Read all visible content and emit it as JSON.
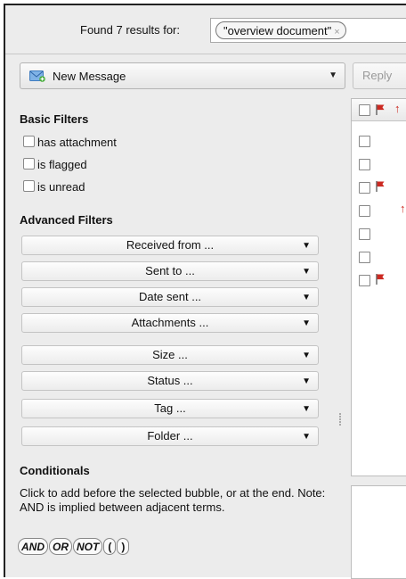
{
  "search": {
    "found_label": "Found 7 results for:",
    "bubble_text": "\"overview document\"",
    "remove_glyph": "×"
  },
  "toolbar": {
    "new_message_label": "New Message",
    "new_message_icon": "envelope-plus-icon",
    "reply_label": "Reply"
  },
  "filters": {
    "basic_heading": "Basic Filters",
    "basic": [
      {
        "label": "has attachment",
        "checked": false
      },
      {
        "label": "is flagged",
        "checked": false
      },
      {
        "label": "is unread",
        "checked": false
      }
    ],
    "advanced_heading": "Advanced Filters",
    "advanced": [
      "Received from ...",
      "Sent to ...",
      "Date sent ...",
      "Attachments ...",
      "Size ...",
      "Status ...",
      "Tag ...",
      "Folder ..."
    ]
  },
  "conditionals": {
    "heading": "Conditionals",
    "description": "Click to add before the selected bubble, or at the end. Note: AND is implied between adjacent terms.",
    "operators": [
      "AND",
      "OR",
      "NOT",
      "(",
      ")"
    ]
  },
  "results": {
    "count": 7,
    "rows": [
      {
        "flagged": false,
        "priority": false
      },
      {
        "flagged": false,
        "priority": false
      },
      {
        "flagged": true,
        "priority": false
      },
      {
        "flagged": false,
        "priority": true
      },
      {
        "flagged": false,
        "priority": false
      },
      {
        "flagged": false,
        "priority": false
      },
      {
        "flagged": true,
        "priority": false
      }
    ]
  },
  "colors": {
    "flag": "#cc2a22",
    "priority": "#cc2a22"
  }
}
